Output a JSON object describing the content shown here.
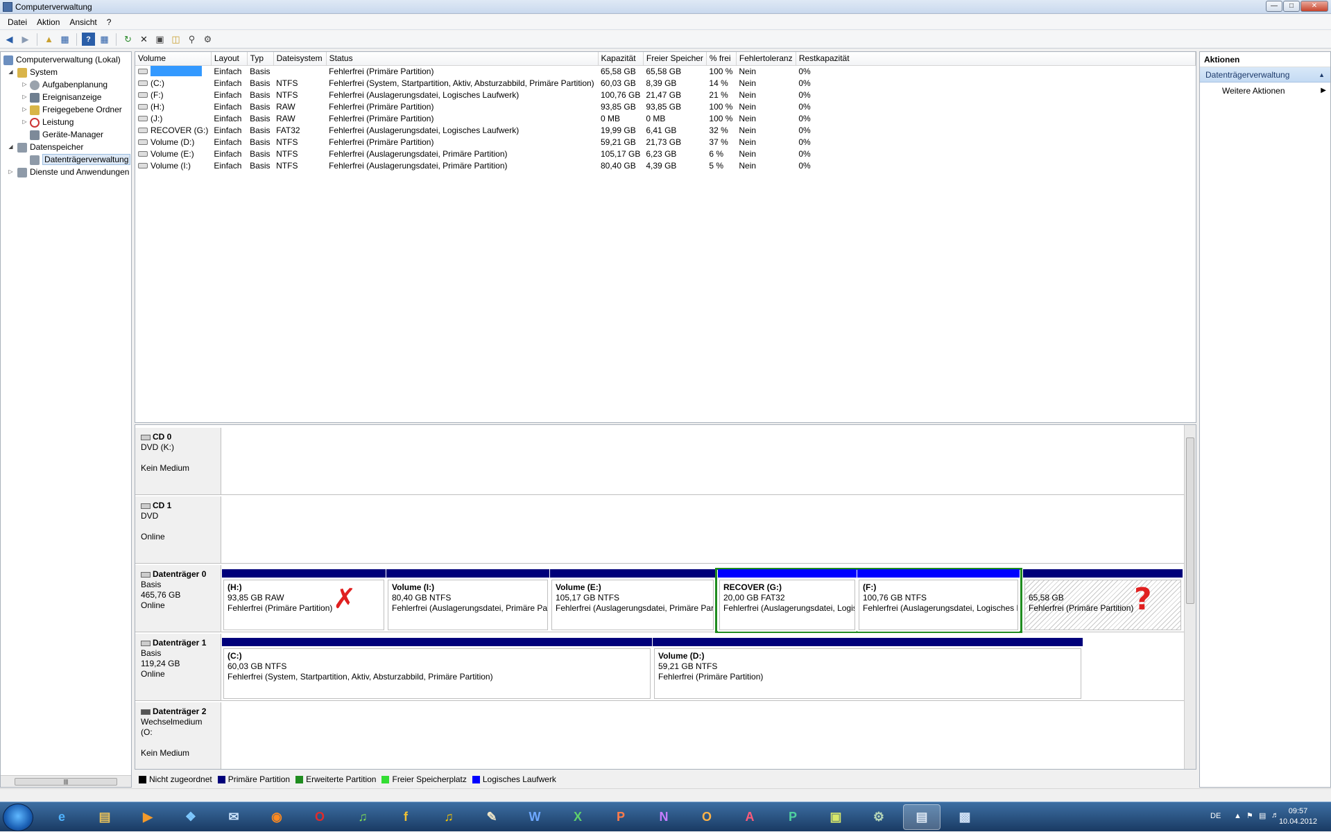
{
  "window": {
    "title": "Computerverwaltung"
  },
  "menu": {
    "file": "Datei",
    "action": "Aktion",
    "view": "Ansicht",
    "help": "?"
  },
  "tree": {
    "root": "Computerverwaltung (Lokal)",
    "system": "System",
    "tasks": "Aufgabenplanung",
    "events": "Ereignisanzeige",
    "shares": "Freigegebene Ordner",
    "perf": "Leistung",
    "devmgr": "Geräte-Manager",
    "storage": "Datenspeicher",
    "diskmgmt": "Datenträgerverwaltung",
    "services": "Dienste und Anwendungen"
  },
  "columns": [
    "Volume",
    "Layout",
    "Typ",
    "Dateisystem",
    "Status",
    "Kapazität",
    "Freier Speicher",
    "% frei",
    "Fehlertoleranz",
    "Restkapazität"
  ],
  "volumes": [
    {
      "name": "",
      "layout": "Einfach",
      "type": "Basis",
      "fs": "",
      "status": "Fehlerfrei (Primäre Partition)",
      "cap": "65,58 GB",
      "free": "65,58 GB",
      "pct": "100 %",
      "ft": "Nein",
      "rest": "0%"
    },
    {
      "name": "(C:)",
      "layout": "Einfach",
      "type": "Basis",
      "fs": "NTFS",
      "status": "Fehlerfrei (System, Startpartition, Aktiv, Absturzabbild, Primäre Partition)",
      "cap": "60,03 GB",
      "free": "8,39 GB",
      "pct": "14 %",
      "ft": "Nein",
      "rest": "0%"
    },
    {
      "name": "(F:)",
      "layout": "Einfach",
      "type": "Basis",
      "fs": "NTFS",
      "status": "Fehlerfrei (Auslagerungsdatei, Logisches Laufwerk)",
      "cap": "100,76 GB",
      "free": "21,47 GB",
      "pct": "21 %",
      "ft": "Nein",
      "rest": "0%"
    },
    {
      "name": "(H:)",
      "layout": "Einfach",
      "type": "Basis",
      "fs": "RAW",
      "status": "Fehlerfrei (Primäre Partition)",
      "cap": "93,85 GB",
      "free": "93,85 GB",
      "pct": "100 %",
      "ft": "Nein",
      "rest": "0%"
    },
    {
      "name": "(J:)",
      "layout": "Einfach",
      "type": "Basis",
      "fs": "RAW",
      "status": "Fehlerfrei (Primäre Partition)",
      "cap": "0 MB",
      "free": "0 MB",
      "pct": "100 %",
      "ft": "Nein",
      "rest": "0%"
    },
    {
      "name": "RECOVER (G:)",
      "layout": "Einfach",
      "type": "Basis",
      "fs": "FAT32",
      "status": "Fehlerfrei (Auslagerungsdatei, Logisches Laufwerk)",
      "cap": "19,99 GB",
      "free": "6,41 GB",
      "pct": "32 %",
      "ft": "Nein",
      "rest": "0%"
    },
    {
      "name": "Volume (D:)",
      "layout": "Einfach",
      "type": "Basis",
      "fs": "NTFS",
      "status": "Fehlerfrei (Primäre Partition)",
      "cap": "59,21 GB",
      "free": "21,73 GB",
      "pct": "37 %",
      "ft": "Nein",
      "rest": "0%"
    },
    {
      "name": "Volume (E:)",
      "layout": "Einfach",
      "type": "Basis",
      "fs": "NTFS",
      "status": "Fehlerfrei (Auslagerungsdatei, Primäre Partition)",
      "cap": "105,17 GB",
      "free": "6,23 GB",
      "pct": "6 %",
      "ft": "Nein",
      "rest": "0%"
    },
    {
      "name": "Volume (I:)",
      "layout": "Einfach",
      "type": "Basis",
      "fs": "NTFS",
      "status": "Fehlerfrei (Auslagerungsdatei, Primäre Partition)",
      "cap": "80,40 GB",
      "free": "4,39 GB",
      "pct": "5 %",
      "ft": "Nein",
      "rest": "0%"
    }
  ],
  "disks": {
    "cd0": {
      "name": "CD 0",
      "l1": "DVD (K:)",
      "l2": "",
      "l3": "Kein Medium"
    },
    "cd1": {
      "name": "CD 1",
      "l1": "DVD",
      "l2": "",
      "l3": "Online"
    },
    "d0": {
      "name": "Datenträger 0",
      "l1": "Basis",
      "l2": "465,76 GB",
      "l3": "Online",
      "parts": [
        {
          "n": "(H:)",
          "s": "93,85 GB RAW",
          "st": "Fehlerfrei (Primäre Partition)"
        },
        {
          "n": "Volume  (I:)",
          "s": "80,40 GB NTFS",
          "st": "Fehlerfrei (Auslagerungsdatei, Primäre Pa"
        },
        {
          "n": "Volume  (E:)",
          "s": "105,17 GB NTFS",
          "st": "Fehlerfrei (Auslagerungsdatei, Primäre Part"
        },
        {
          "n": "RECOVER  (G:)",
          "s": "20,00 GB FAT32",
          "st": "Fehlerfrei (Auslagerungsdatei, Logis"
        },
        {
          "n": "(F:)",
          "s": "100,76 GB NTFS",
          "st": "Fehlerfrei (Auslagerungsdatei, Logisches L"
        },
        {
          "n": "",
          "s": "65,58 GB",
          "st": "Fehlerfrei (Primäre Partition)"
        }
      ]
    },
    "d1": {
      "name": "Datenträger 1",
      "l1": "Basis",
      "l2": "119,24 GB",
      "l3": "Online",
      "parts": [
        {
          "n": "(C:)",
          "s": "60,03 GB NTFS",
          "st": "Fehlerfrei (System, Startpartition, Aktiv, Absturzabbild, Primäre Partition)"
        },
        {
          "n": "Volume  (D:)",
          "s": "59,21 GB NTFS",
          "st": "Fehlerfrei (Primäre Partition)"
        }
      ]
    },
    "d2": {
      "name": "Datenträger 2",
      "l1": "Wechselmedium (O:",
      "l2": "",
      "l3": "Kein Medium"
    }
  },
  "legend": [
    "Nicht zugeordnet",
    "Primäre Partition",
    "Erweiterte Partition",
    "Freier Speicherplatz",
    "Logisches Laufwerk"
  ],
  "colors": {
    "unallocated": "#000000",
    "primary": "#00007a",
    "extended": "#1f8c1f",
    "free": "#33dd33",
    "logical": "#0000ff"
  },
  "actions": {
    "title": "Aktionen",
    "section": "Datenträgerverwaltung",
    "more": "Weitere Aktionen"
  },
  "tray": {
    "lang": "DE",
    "time": "09:57",
    "date": "10.04.2012"
  }
}
